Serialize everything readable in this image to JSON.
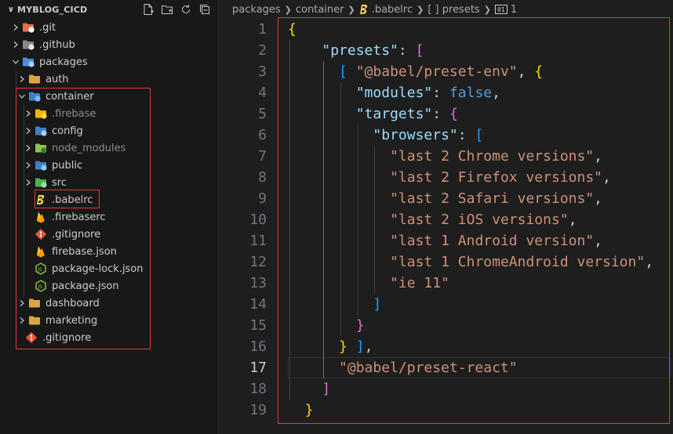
{
  "colors": {
    "highlight_border": "#e5383b",
    "editor_bg": "#1e1e1e",
    "sidebar_bg": "#181818"
  },
  "explorer": {
    "title": "MYBLOG_CICD",
    "actions": [
      "new-file-icon",
      "new-folder-icon",
      "refresh-icon",
      "collapse-all-icon"
    ],
    "items": [
      {
        "label": ".git",
        "type": "folder",
        "expanded": false,
        "icon": "git-folder-icon",
        "dim": false
      },
      {
        "label": ".github",
        "type": "folder",
        "expanded": false,
        "icon": "github-folder-icon",
        "dim": false
      },
      {
        "label": "packages",
        "type": "folder",
        "expanded": true,
        "icon": "packages-folder-icon",
        "dim": false
      },
      {
        "label": "auth",
        "type": "folder",
        "expanded": false,
        "icon": "folder-icon",
        "dim": false
      },
      {
        "label": "container",
        "type": "folder",
        "expanded": true,
        "icon": "container-folder-icon",
        "dim": false
      },
      {
        "label": ".firebase",
        "type": "folder",
        "expanded": false,
        "icon": "firebase-folder-icon",
        "dim": true
      },
      {
        "label": "config",
        "type": "folder",
        "expanded": false,
        "icon": "config-folder-icon",
        "dim": false
      },
      {
        "label": "node_modules",
        "type": "folder",
        "expanded": false,
        "icon": "node-modules-folder-icon",
        "dim": true
      },
      {
        "label": "public",
        "type": "folder",
        "expanded": false,
        "icon": "public-folder-icon",
        "dim": false
      },
      {
        "label": "src",
        "type": "folder",
        "expanded": false,
        "icon": "src-folder-icon",
        "dim": false
      },
      {
        "label": ".babelrc",
        "type": "file",
        "icon": "babel-file-icon",
        "dim": false
      },
      {
        "label": ".firebaserc",
        "type": "file",
        "icon": "firebase-file-icon",
        "dim": false
      },
      {
        "label": ".gitignore",
        "type": "file",
        "icon": "git-file-icon",
        "dim": false
      },
      {
        "label": "firebase.json",
        "type": "file",
        "icon": "firebase-file-icon",
        "dim": false
      },
      {
        "label": "package-lock.json",
        "type": "file",
        "icon": "node-file-icon",
        "dim": false
      },
      {
        "label": "package.json",
        "type": "file",
        "icon": "node-file-icon",
        "dim": false
      },
      {
        "label": "dashboard",
        "type": "folder",
        "expanded": false,
        "icon": "folder-icon",
        "dim": false
      },
      {
        "label": "marketing",
        "type": "folder",
        "expanded": false,
        "icon": "folder-icon",
        "dim": false
      },
      {
        "label": ".gitignore",
        "type": "file",
        "icon": "git-file-icon",
        "dim": false
      }
    ]
  },
  "breadcrumbs": {
    "items": [
      "packages",
      "container",
      ".babelrc",
      "[ ] presets",
      "1"
    ],
    "icons": [
      "",
      "",
      "babel-file-icon",
      "",
      "symbol-icon"
    ]
  },
  "editor": {
    "active_line": 17,
    "lines": [
      [
        [
          "{",
          "brace"
        ]
      ],
      [
        [
          "\"presets\"",
          "key"
        ],
        [
          ": ",
          "punc"
        ],
        [
          "[",
          "bracket-p"
        ]
      ],
      [
        [
          "[ ",
          "bracket-b"
        ],
        [
          "\"@babel/preset-env\"",
          "str"
        ],
        [
          ", ",
          "punc"
        ],
        [
          "{",
          "brace"
        ]
      ],
      [
        [
          "\"modules\"",
          "key"
        ],
        [
          ": ",
          "punc"
        ],
        [
          "false",
          "bool"
        ],
        [
          ",",
          "punc"
        ]
      ],
      [
        [
          "\"targets\"",
          "key"
        ],
        [
          ": ",
          "punc"
        ],
        [
          "{",
          "bracket-p"
        ]
      ],
      [
        [
          "\"browsers\"",
          "key"
        ],
        [
          ": ",
          "punc"
        ],
        [
          "[",
          "bracket-b"
        ]
      ],
      [
        [
          "\"last 2 Chrome versions\"",
          "str"
        ],
        [
          ",",
          "punc"
        ]
      ],
      [
        [
          "\"last 2 Firefox versions\"",
          "str"
        ],
        [
          ",",
          "punc"
        ]
      ],
      [
        [
          "\"last 2 Safari versions\"",
          "str"
        ],
        [
          ",",
          "punc"
        ]
      ],
      [
        [
          "\"last 2 iOS versions\"",
          "str"
        ],
        [
          ",",
          "punc"
        ]
      ],
      [
        [
          "\"last 1 Android version\"",
          "str"
        ],
        [
          ",",
          "punc"
        ]
      ],
      [
        [
          "\"last 1 ChromeAndroid version\"",
          "str"
        ],
        [
          ",",
          "punc"
        ]
      ],
      [
        [
          "\"ie 11\"",
          "str"
        ]
      ],
      [
        [
          "]",
          "bracket-b"
        ]
      ],
      [
        [
          "}",
          "bracket-p"
        ]
      ],
      [
        [
          "} ",
          "brace"
        ],
        [
          "]",
          "bracket-b"
        ],
        [
          ",",
          "punc"
        ]
      ],
      [
        [
          "\"@babel/preset-react\"",
          "str"
        ]
      ],
      [
        [
          "]",
          "bracket-p"
        ]
      ],
      [
        [
          "}",
          "brace"
        ]
      ]
    ]
  }
}
